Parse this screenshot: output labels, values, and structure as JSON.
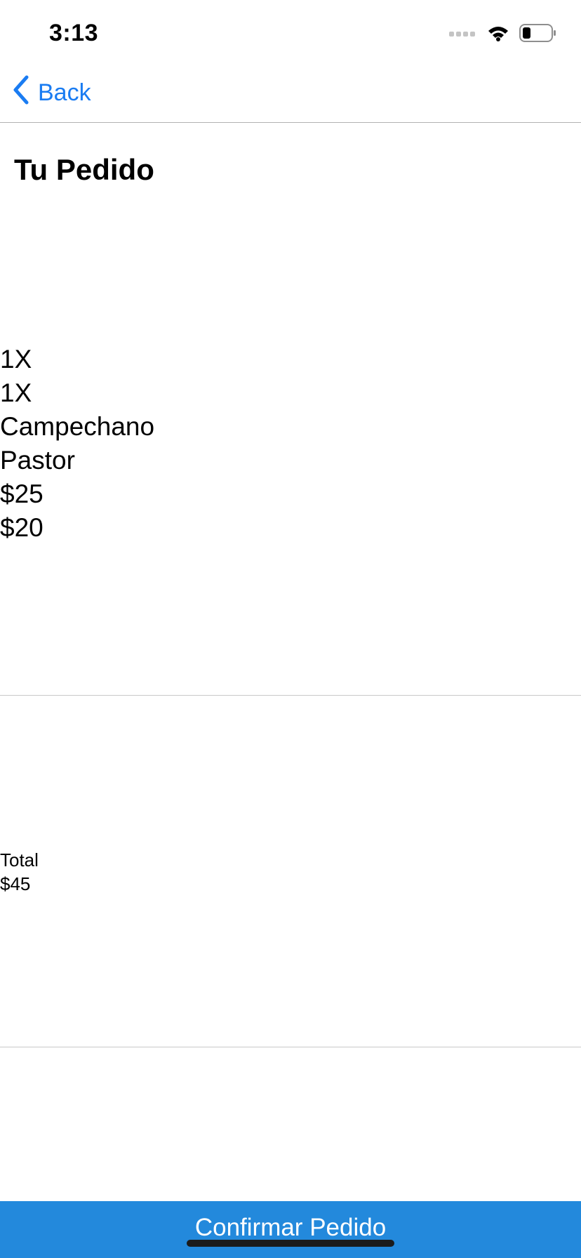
{
  "status_bar": {
    "time": "3:13",
    "icons": [
      "signal-icon",
      "wifi-icon",
      "battery-icon"
    ]
  },
  "nav": {
    "back_label": "Back",
    "back_icon": "chevron-left-icon",
    "accent_color": "#1a7cf2"
  },
  "page": {
    "title": "Tu Pedido"
  },
  "order": {
    "quantities": [
      "1X",
      "1X"
    ],
    "names": [
      "Campechano",
      "Pastor"
    ],
    "prices": [
      "$25",
      "$20"
    ]
  },
  "total": {
    "label": "Total",
    "value": "$45"
  },
  "confirm": {
    "label": "Confirmar Pedido",
    "color": "#2389dc"
  }
}
